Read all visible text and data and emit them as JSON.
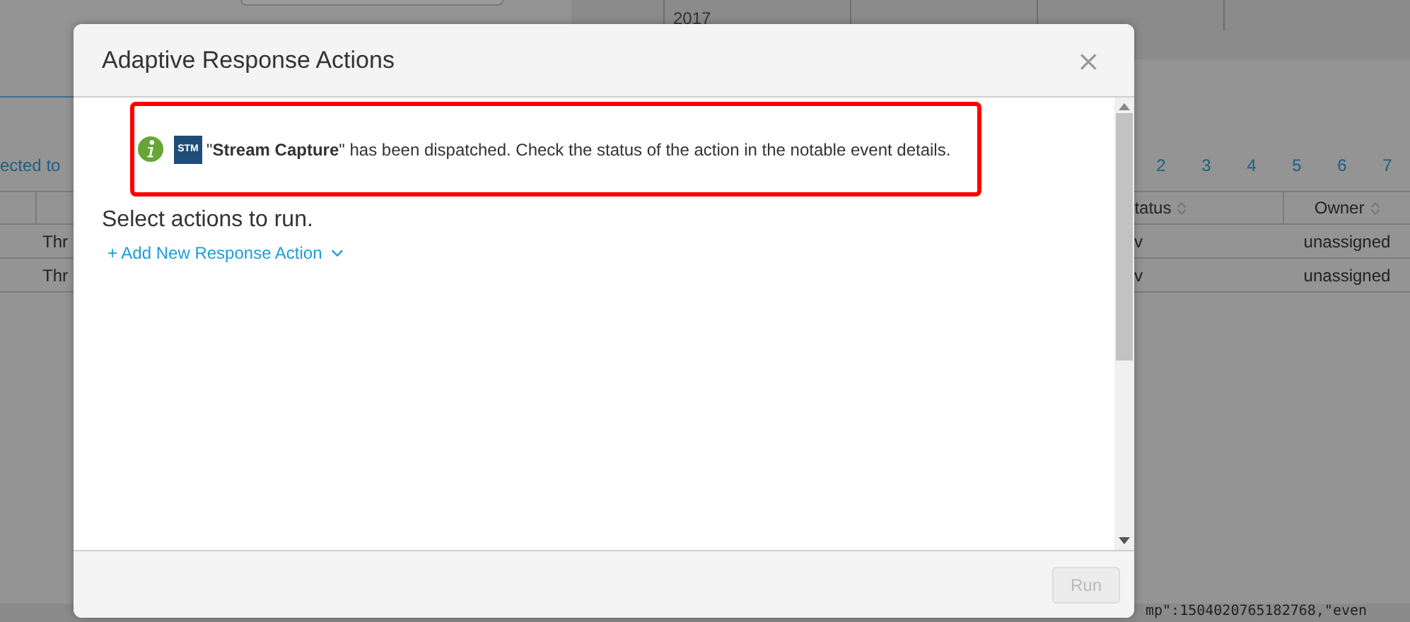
{
  "background": {
    "timeline_year": "2017",
    "filter_link": "ected to",
    "pagination": [
      {
        "label": "2",
        "selected": false
      },
      {
        "label": "3",
        "selected": false
      },
      {
        "label": "4",
        "selected": false
      },
      {
        "label": "5",
        "selected": false
      },
      {
        "label": "6",
        "selected": false
      },
      {
        "label": "7",
        "selected": false
      }
    ],
    "table": {
      "columns": [
        "",
        "tatus",
        "Owner"
      ],
      "rows": [
        {
          "cells": [
            "Thr",
            "v",
            "unassigned"
          ]
        },
        {
          "cells": [
            "Thr",
            "v",
            "unassigned"
          ]
        }
      ]
    },
    "log_text": "mp\":1504020765182768,\"even"
  },
  "modal": {
    "title": "Adaptive Response Actions",
    "close": "×",
    "alert": {
      "badge": "STM",
      "message": "\"**Stream Capture**\" has been dispatched. Check the status of the action in the notable event details."
    },
    "heading": "Select actions to run.",
    "add_link": "+ Add New Response Action",
    "buttons": [
      {
        "label": "Run",
        "disabled": true
      }
    ]
  }
}
